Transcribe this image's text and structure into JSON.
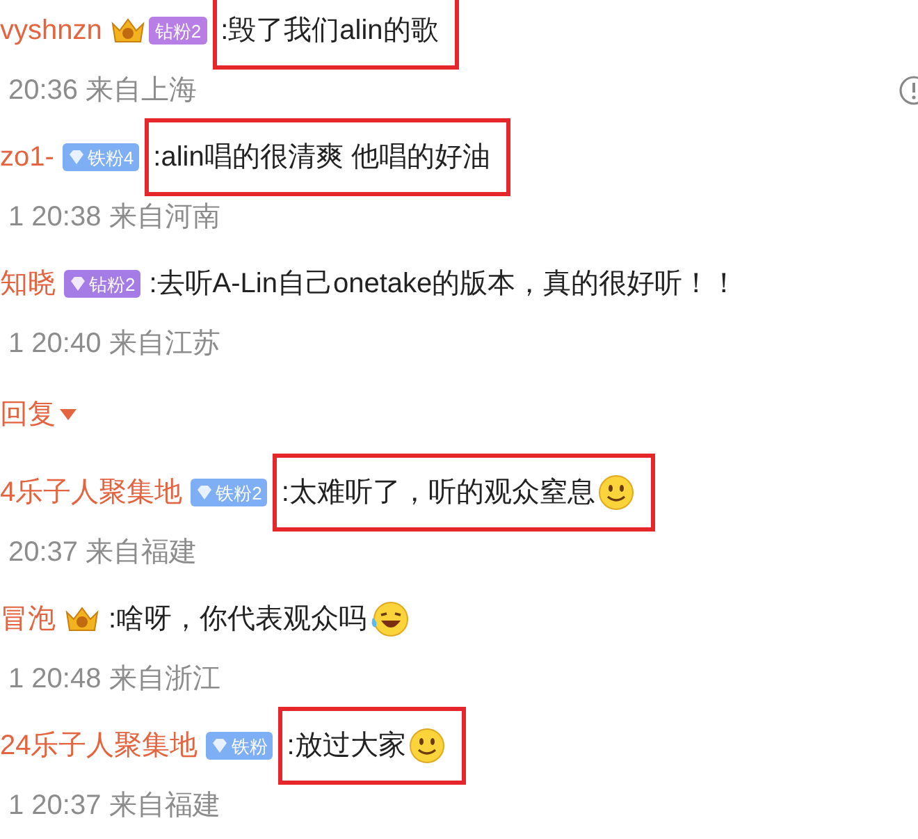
{
  "comments": [
    {
      "name": "vyshnzn",
      "badge": {
        "kind": "crown_diamond",
        "text": "钻粉2"
      },
      "text": ":毁了我们alin的歌",
      "highlighted": true,
      "meta": "20:36 来自上海",
      "info_icon": true
    },
    {
      "name": "zo1-",
      "badge": {
        "kind": "iron",
        "text": "铁粉4"
      },
      "text": ":alin唱的很清爽 他唱的好油",
      "highlighted": true,
      "meta": "1 20:38 来自河南"
    },
    {
      "name": "知晓",
      "badge": {
        "kind": "diamond",
        "text": "钻粉2"
      },
      "text": ":去听A-Lin自己onetake的版本，真的很好听！！",
      "highlighted": false,
      "meta": "1 20:40 来自江苏"
    }
  ],
  "reply_toggle": {
    "label": "回复",
    "expanded": false
  },
  "replies": [
    {
      "name": "4乐子人聚集地",
      "badge": {
        "kind": "iron",
        "text": "铁粉2"
      },
      "text": ":太难听了，听的观众窒息",
      "emoji": {
        "kind": "smile"
      },
      "highlighted": true,
      "meta": "20:37 来自福建"
    },
    {
      "name": "冒泡",
      "badge": {
        "kind": "crown"
      },
      "text": ":啥呀，你代表观众吗",
      "emoji": {
        "kind": "laugh_cry"
      },
      "highlighted": false,
      "meta": "1 20:48 来自浙江"
    },
    {
      "name": "24乐子人聚集地",
      "badge": {
        "kind": "iron",
        "text": "铁粉"
      },
      "text": ":放过大家",
      "emoji": {
        "kind": "smile"
      },
      "highlighted": true,
      "meta": "1 20:37 来自福建"
    }
  ]
}
